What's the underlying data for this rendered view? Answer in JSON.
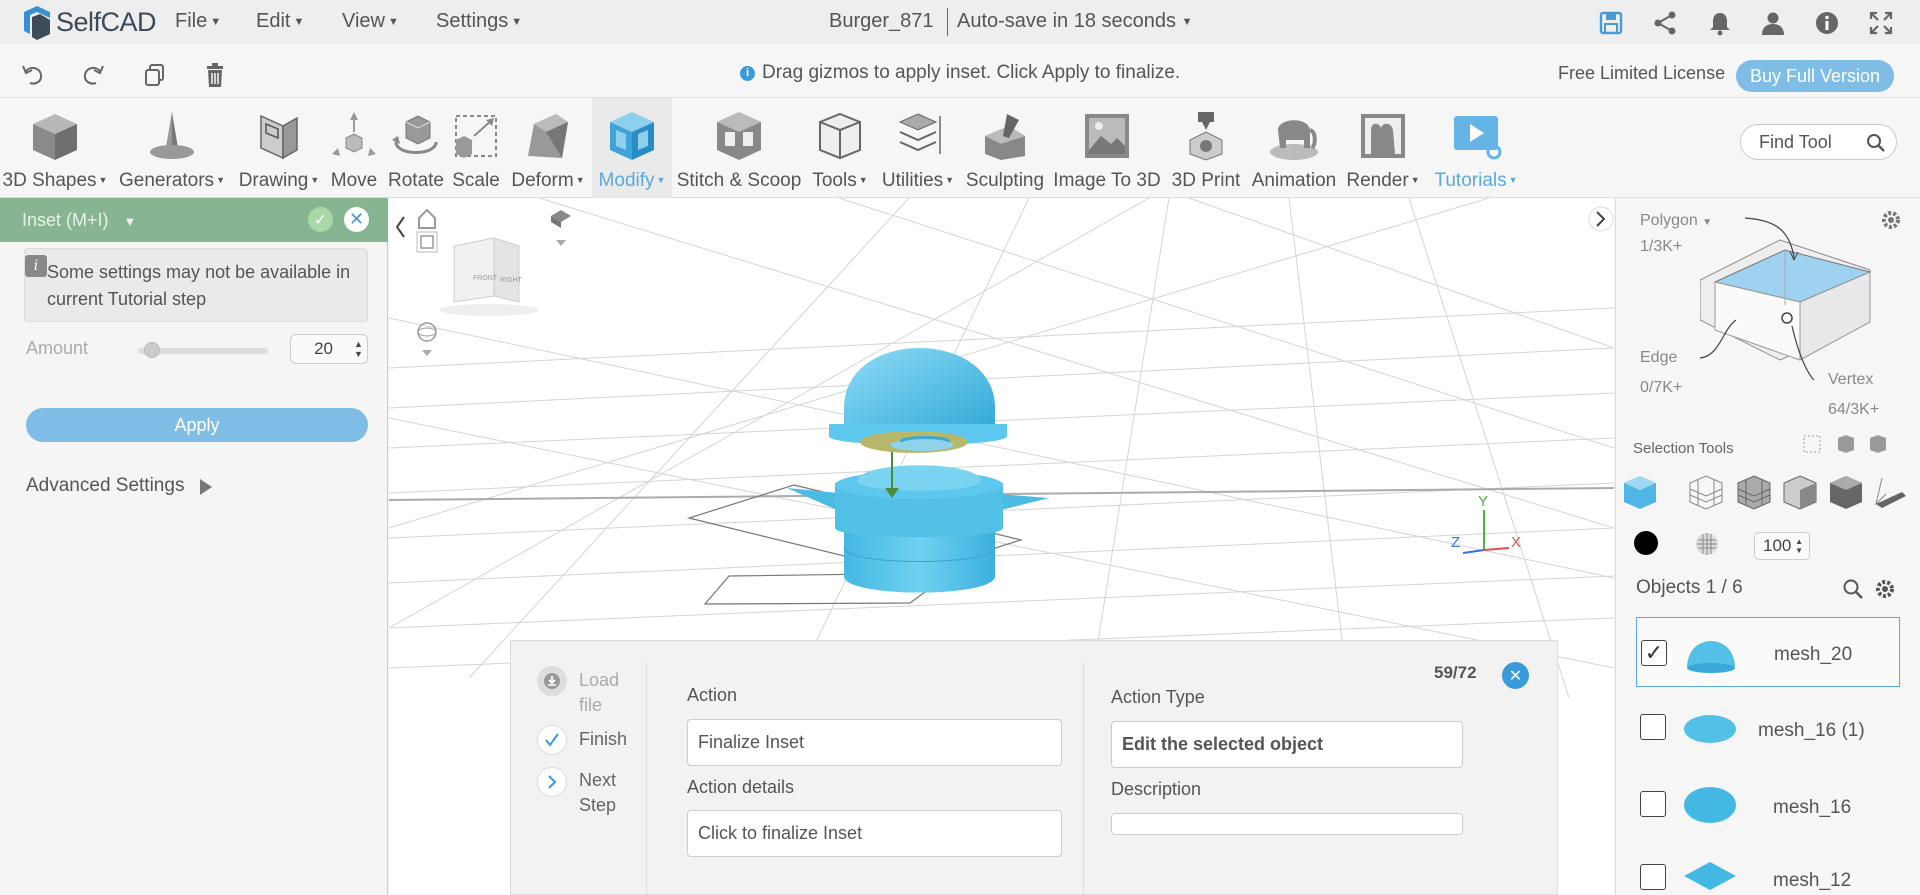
{
  "app": {
    "name": "SelfCAD"
  },
  "menu": {
    "file": "File",
    "edit": "Edit",
    "view": "View",
    "settings": "Settings"
  },
  "document": {
    "title": "Burger_871",
    "autosave": "Auto-save in 18 seconds"
  },
  "hint": "Drag gizmos to apply inset. Click Apply to finalize.",
  "license": {
    "label": "Free Limited License",
    "buy": "Buy Full Version"
  },
  "toolbar": {
    "shapes": "3D Shapes",
    "generators": "Generators",
    "drawing": "Drawing",
    "move": "Move",
    "rotate": "Rotate",
    "scale": "Scale",
    "deform": "Deform",
    "modify": "Modify",
    "stitch": "Stitch & Scoop",
    "tools": "Tools",
    "utilities": "Utilities",
    "sculpting": "Sculpting",
    "image3d": "Image To 3D",
    "print": "3D Print",
    "animation": "Animation",
    "render": "Render",
    "tutorials": "Tutorials",
    "find": "Find Tool"
  },
  "panel": {
    "title": "Inset (M+I)",
    "notice": "Some settings may not be available in current Tutorial step",
    "amount_label": "Amount",
    "amount_value": "20",
    "amount_fraction": 0.05,
    "apply": "Apply",
    "advanced": "Advanced Settings"
  },
  "viewcube": {
    "front": "FRONT",
    "right": "RIGHT"
  },
  "axes": {
    "x": "X",
    "y": "Y",
    "z": "Z"
  },
  "tutorial": {
    "load_file": "Load file",
    "finish": "Finish",
    "next_step": "Next Step",
    "action_label": "Action",
    "action_value": "Finalize Inset",
    "details_label": "Action details",
    "details_value": "Click to finalize Inset",
    "type_label": "Action Type",
    "type_value": "Edit the selected object",
    "description_label": "Description",
    "description_value": "",
    "counter": "59/72"
  },
  "selection": {
    "polygon": "Polygon",
    "polygon_count": "1/3K+",
    "edge": "Edge",
    "edge_count": "0/7K+",
    "vertex": "Vertex",
    "vertex_count": "64/3K+",
    "tools_label": "Selection Tools",
    "opacity": "100"
  },
  "objects": {
    "title": "Objects 1 / 6",
    "items": [
      {
        "name": "mesh_20",
        "checked": true
      },
      {
        "name": "mesh_16 (1)",
        "checked": false
      },
      {
        "name": "mesh_16",
        "checked": false
      },
      {
        "name": "mesh_12",
        "checked": false
      }
    ]
  },
  "colors": {
    "accent": "#5aa9de",
    "mesh": "#4fc3e8",
    "header_green": "#88b591",
    "button": "#7fbde6"
  }
}
